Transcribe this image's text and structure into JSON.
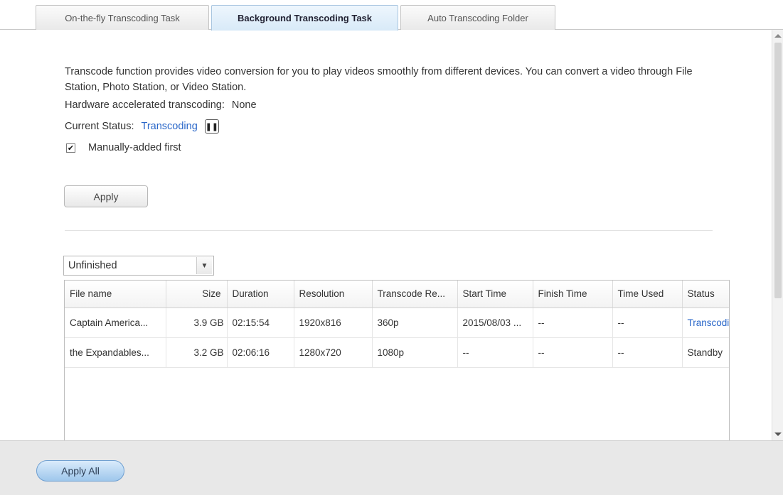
{
  "tabs": [
    {
      "label": "On-the-fly Transcoding Task"
    },
    {
      "label": "Background Transcoding Task"
    },
    {
      "label": "Auto Transcoding Folder"
    }
  ],
  "description": "Transcode function provides video conversion for you to play videos smoothly from different devices. You can convert a video through File Station, Photo Station, or Video Station.",
  "hardware": {
    "label": "Hardware accelerated transcoding:",
    "value": "None"
  },
  "status": {
    "label": "Current Status:",
    "value": "Transcoding",
    "pause_icon": "pause-icon"
  },
  "manual_first": {
    "label": "Manually-added first",
    "checked": true
  },
  "apply_label": "Apply",
  "filter": {
    "selected": "Unfinished"
  },
  "table": {
    "columns": [
      "File name",
      "Size",
      "Duration",
      "Resolution",
      "Transcode Re...",
      "Start Time",
      "Finish Time",
      "Time Used",
      "Status"
    ],
    "rows": [
      {
        "file": "Captain America...",
        "size": "3.9 GB",
        "duration": "02:15:54",
        "resolution": "1920x816",
        "transcode": "360p",
        "start": "2015/08/03 ...",
        "finish": "--",
        "used": "--",
        "status": "Transcoding"
      },
      {
        "file": "the Expandables...",
        "size": "3.2 GB",
        "duration": "02:06:16",
        "resolution": "1280x720",
        "transcode": "1080p",
        "start": "--",
        "finish": "--",
        "used": "--",
        "status": "Standby"
      }
    ]
  },
  "footer": {
    "apply_all_label": "Apply All"
  },
  "colors": {
    "accent": "#2a67c9",
    "tab_active_bg": "#d8eaf8",
    "footer_bg": "#e8e8e8"
  }
}
